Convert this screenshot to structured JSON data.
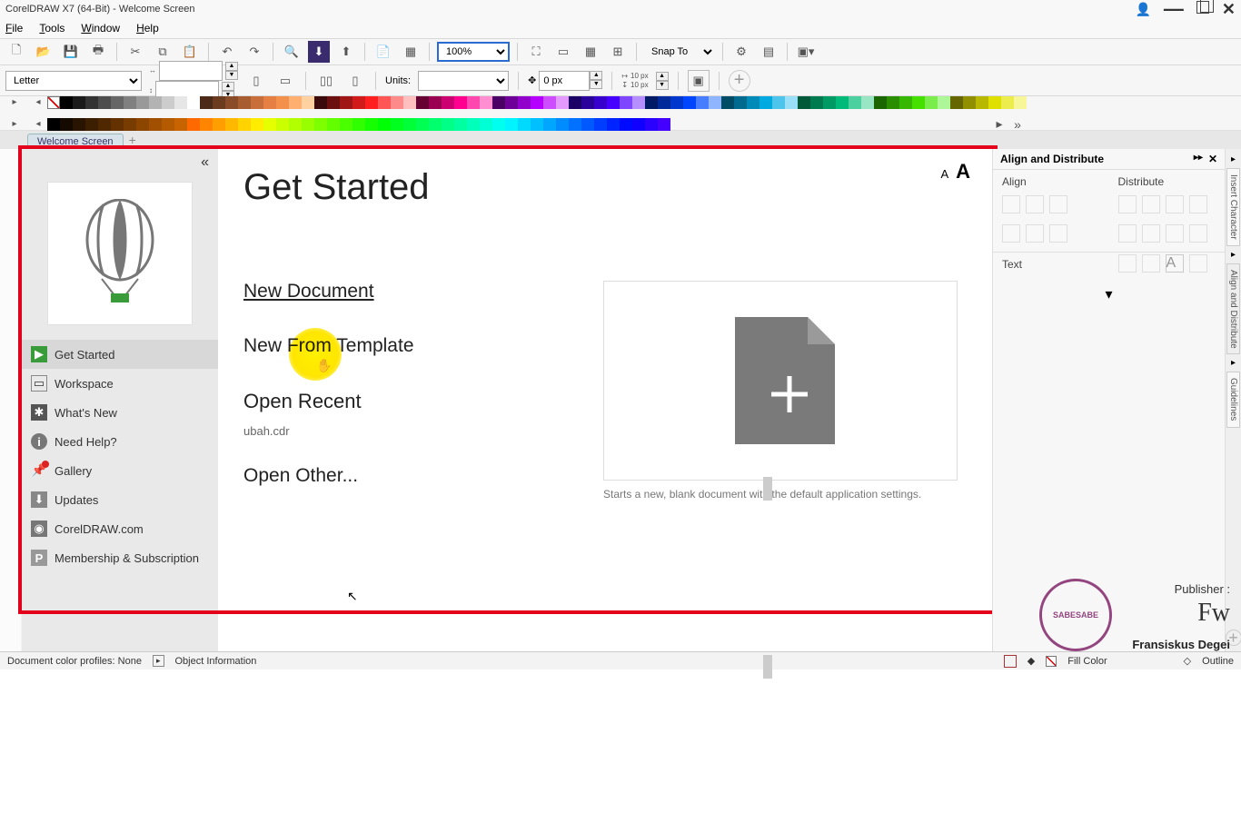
{
  "titlebar": {
    "app_title": "CorelDRAW X7 (64-Bit) - Welcome Screen"
  },
  "menu": {
    "file": "File",
    "tools": "Tools",
    "window": "Window",
    "help": "Help"
  },
  "toolbar": {
    "zoom": "100%",
    "snap_to": "Snap To"
  },
  "propbar": {
    "paper": "Letter",
    "units_label": "Units:",
    "pos_value": "0 px",
    "dup_x": "10 px",
    "dup_y": "10 px"
  },
  "doctab": {
    "active": "Welcome Screen"
  },
  "welcome": {
    "title": "Get Started",
    "nav": {
      "get_started": "Get Started",
      "workspace": "Workspace",
      "whats_new": "What's New",
      "need_help": "Need Help?",
      "gallery": "Gallery",
      "updates": "Updates",
      "coreldraw_com": "CorelDRAW.com",
      "membership": "Membership & Subscription"
    },
    "links": {
      "new_document": "New Document",
      "new_from_template": "New From Template",
      "open_recent": "Open Recent",
      "recent_file": "ubah.cdr",
      "open_other": "Open Other...",
      "preview_desc": "Starts a new, blank document with the default application settings."
    }
  },
  "dock": {
    "panel_title": "Align and Distribute",
    "align_label": "Align",
    "distribute_label": "Distribute",
    "text_label": "Text"
  },
  "vtabs": {
    "insert_char": "Insert Character",
    "align_distribute": "Align and Distribute",
    "guidelines": "Guidelines"
  },
  "statusbar": {
    "profiles": "Document color profiles: None",
    "object_info": "Object Information",
    "fill_color": "Fill Color",
    "outline": "Outline"
  },
  "watermark": {
    "publisher_label": "Publisher :",
    "stamp_text": "SABESABE",
    "name": "Fransiskus Degei"
  },
  "colors_row1": [
    "#000000",
    "#1a1a1a",
    "#333333",
    "#4d4d4d",
    "#666666",
    "#808080",
    "#999999",
    "#b3b3b3",
    "#cccccc",
    "#e6e6e6",
    "#ffffff",
    "#4b2a17",
    "#6b3b1f",
    "#8a4c28",
    "#a85d31",
    "#c76e3a",
    "#e57f43",
    "#f3904b",
    "#ffb070",
    "#ffd0a0",
    "#3b0a0a",
    "#6b0f0f",
    "#a01515",
    "#d11a1a",
    "#ff1f1f",
    "#ff5555",
    "#ff8a8a",
    "#ffbfbf",
    "#660033",
    "#990052",
    "#cc0070",
    "#ff008f",
    "#ff47b0",
    "#ff8fd0",
    "#4b0066",
    "#6e0099",
    "#9200cc",
    "#b600ff",
    "#cd4cff",
    "#e499ff",
    "#1a0066",
    "#290099",
    "#3700cc",
    "#4600ff",
    "#7e47ff",
    "#b58fff",
    "#001a66",
    "#002999",
    "#0037cc",
    "#0046ff",
    "#477eff",
    "#8fb5ff",
    "#004b66",
    "#006b8f",
    "#008ab8",
    "#00a9e0",
    "#4cc4ec",
    "#99dff7",
    "#005a3a",
    "#007a4f",
    "#009a64",
    "#00ba79",
    "#4cd09f",
    "#99e6c5",
    "#1a6600",
    "#298f00",
    "#37b800",
    "#46e000",
    "#7aec4c",
    "#adf799",
    "#666600",
    "#8f8f00",
    "#b8b800",
    "#e0e000",
    "#ecec4c",
    "#f7f799"
  ],
  "colors_row2": [
    "#000000",
    "#140a00",
    "#281400",
    "#3c1e00",
    "#502800",
    "#643200",
    "#783c00",
    "#8c4600",
    "#a05000",
    "#b45a00",
    "#c86400",
    "#ff6a00",
    "#ff8400",
    "#ff9e00",
    "#ffb800",
    "#ffd200",
    "#ffec00",
    "#e5ff00",
    "#cbff00",
    "#b1ff00",
    "#97ff00",
    "#7dff00",
    "#63ff00",
    "#49ff00",
    "#2fff00",
    "#15ff00",
    "#00ff05",
    "#00ff1f",
    "#00ff39",
    "#00ff53",
    "#00ff6d",
    "#00ff87",
    "#00ffa1",
    "#00ffbb",
    "#00ffd5",
    "#00ffef",
    "#00f4ff",
    "#00daff",
    "#00c0ff",
    "#00a6ff",
    "#008cff",
    "#0072ff",
    "#0058ff",
    "#003eff",
    "#0024ff",
    "#000aff",
    "#1000ff",
    "#2a00ff",
    "#4400ff"
  ]
}
